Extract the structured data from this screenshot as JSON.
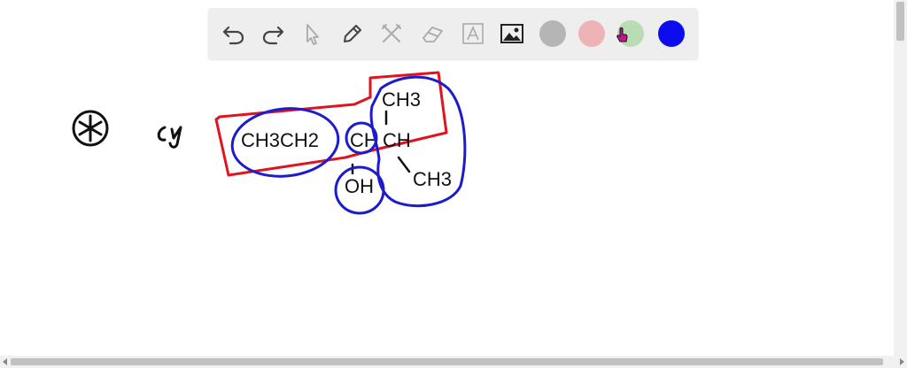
{
  "toolbar": {
    "tools": [
      "undo-icon",
      "redo-icon",
      "pointer-icon",
      "pencil-icon",
      "tools-icon",
      "eraser-icon",
      "text-icon",
      "image-icon"
    ],
    "colors": [
      "#b5b5b5",
      "#eeb3b6",
      "#b9dcb5",
      "#0c0cee"
    ],
    "selected_color": "#b9dcb5"
  },
  "drawing": {
    "label_star": "*",
    "label_part": "(a)",
    "formula_left": "CH3CH2",
    "junction": "CH",
    "center": "CH",
    "methyl_top": "CH3",
    "methyl_bottom": "CH3",
    "hydroxyl": "OH",
    "ink_colors": {
      "black": "#111111",
      "red": "#e0141e",
      "blue": "#1c1ccc"
    }
  }
}
